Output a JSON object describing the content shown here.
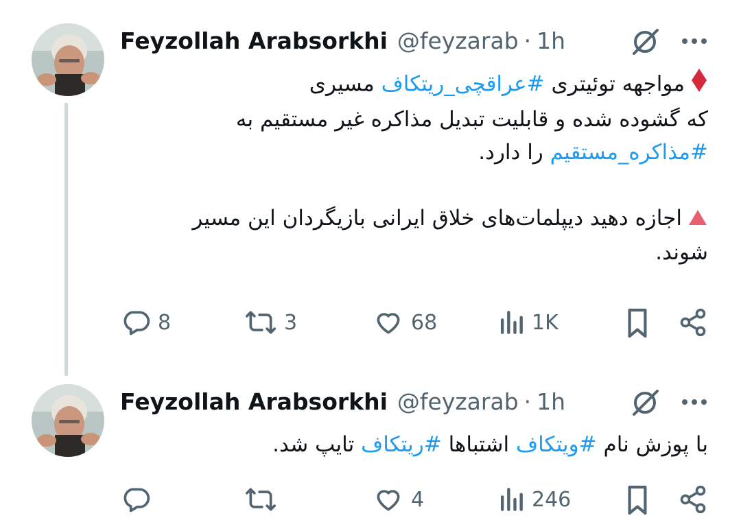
{
  "tweets": [
    {
      "author": "Feyzollah Arabsorkhi",
      "handle": "@feyzarab",
      "separator": "·",
      "time": "1h",
      "lines": [
        {
          "marker": "red-diamond",
          "parts": [
            {
              "t": "مواجهه توئیتری "
            },
            {
              "t": "#عراقچی_ریتکاف",
              "tag": true
            },
            {
              "t": " مسیری"
            }
          ]
        },
        {
          "parts": [
            {
              "t": "که گشوده شده و قابلیت تبدیل مذاکره غیر مستقیم به"
            }
          ]
        },
        {
          "parts": [
            {
              "t": "#مذاکره_مستقیم",
              "tag": true
            },
            {
              "t": " را دارد."
            }
          ]
        },
        {
          "parts": [
            {
              "t": ""
            }
          ]
        },
        {
          "marker": "red-triangle",
          "parts": [
            {
              "t": "اجازه دهید دیپلمات‌های خلاق ایرانی بازیگردان این مسیر"
            }
          ]
        },
        {
          "parts": [
            {
              "t": "شوند."
            }
          ]
        }
      ],
      "stats": {
        "replies": "8",
        "retweets": "3",
        "likes": "68",
        "views": "1K"
      }
    },
    {
      "author": "Feyzollah Arabsorkhi",
      "handle": "@feyzarab",
      "separator": "·",
      "time": "1h",
      "lines": [
        {
          "parts": [
            {
              "t": "با پوزش نام "
            },
            {
              "t": "#ویتکاف",
              "tag": true
            },
            {
              "t": " اشتباها "
            },
            {
              "t": "#ریتکاف",
              "tag": true
            },
            {
              "t": " تایپ شد."
            }
          ]
        }
      ],
      "stats": {
        "replies": "",
        "retweets": "",
        "likes": "4",
        "views": "246"
      }
    }
  ],
  "colors": {
    "text": "#0f1419",
    "secondary": "#536471",
    "hashtag": "#1d9bf0",
    "thread_line": "#cfd9de",
    "marker_red": "#d42b3c",
    "marker_pink": "#e8606e"
  },
  "icons": [
    "grok-icon",
    "more-icon",
    "reply-icon",
    "retweet-icon",
    "like-icon",
    "views-icon",
    "bookmark-icon",
    "share-icon"
  ]
}
